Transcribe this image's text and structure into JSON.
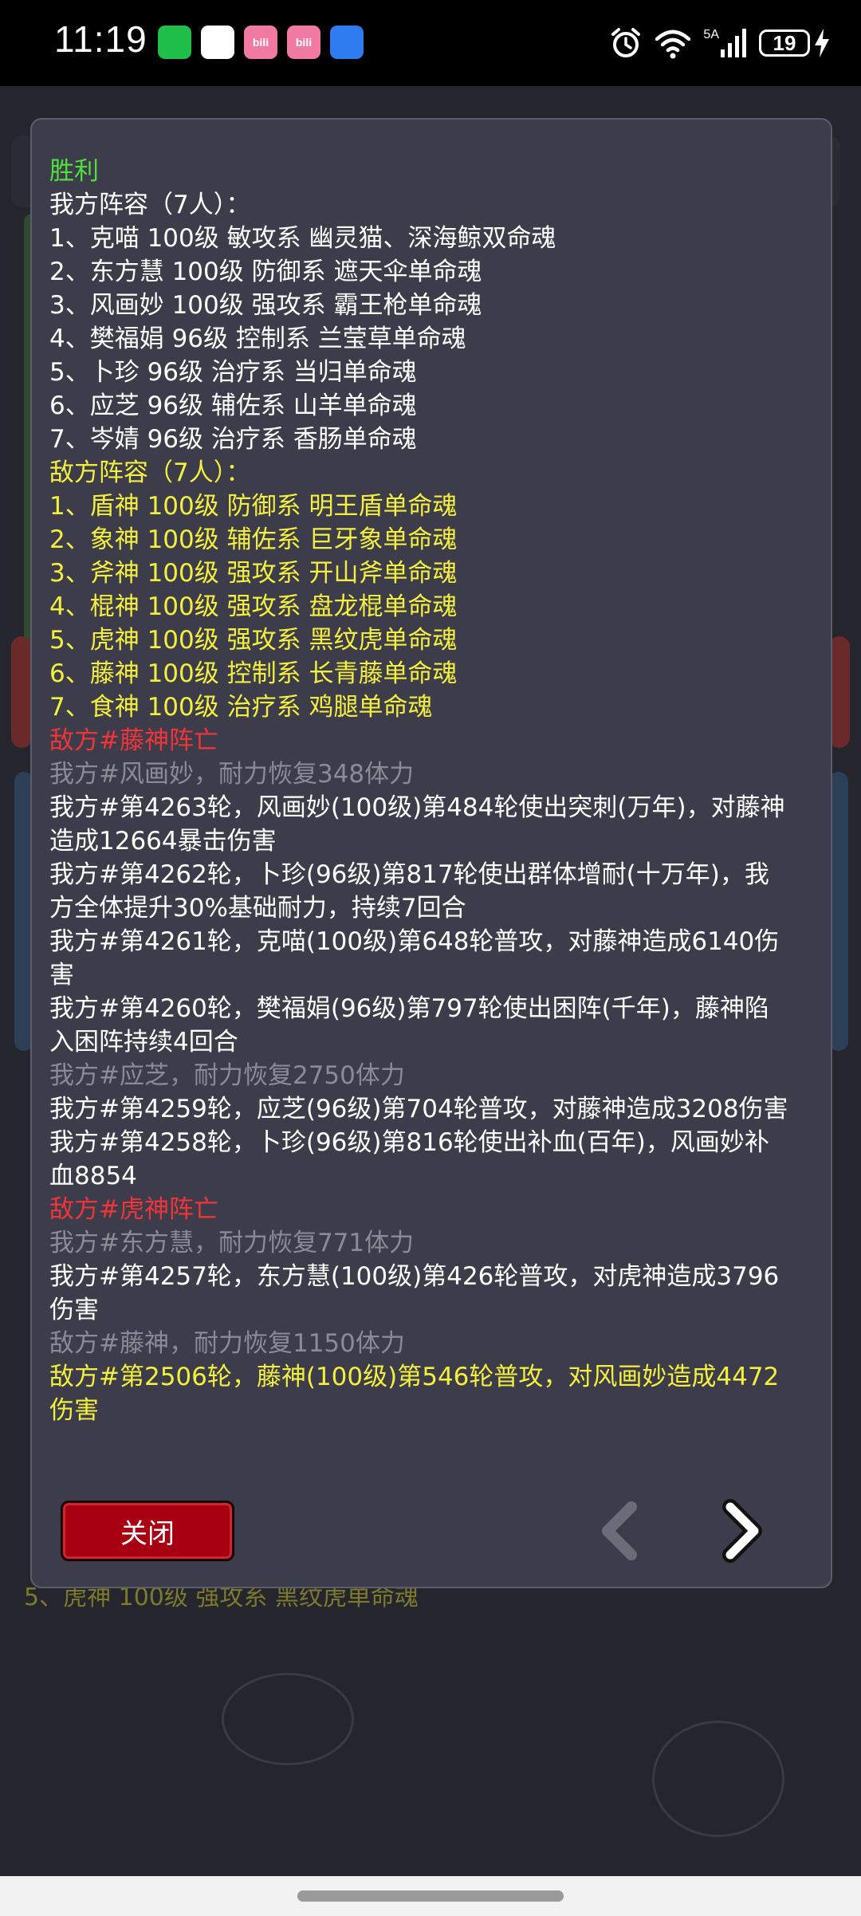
{
  "status_bar": {
    "time": "11:19",
    "apps": [
      {
        "icon": "wechat-icon",
        "color": "#1fbf4a",
        "text": ""
      },
      {
        "icon": "app-q-icon",
        "color": "#ffffff",
        "text": ""
      },
      {
        "icon": "bilibili-icon",
        "color": "#f07aa1",
        "text": "bili"
      },
      {
        "icon": "bilibili-icon-2",
        "color": "#f07aa1",
        "text": "bili"
      },
      {
        "icon": "message-icon",
        "color": "#2f7bf0",
        "text": ""
      }
    ],
    "network": "5A",
    "battery": "19"
  },
  "background": {
    "peek_text": "5、虎神 100级 强攻系 黑纹虎单命魂"
  },
  "dialog": {
    "log_lines": [
      {
        "color": "green",
        "text": "胜利"
      },
      {
        "color": "white",
        "text": "我方阵容（7人）："
      },
      {
        "color": "white",
        "text": "1、克喵 100级 敏攻系 幽灵猫、深海鲸双命魂"
      },
      {
        "color": "white",
        "text": "2、东方慧 100级 防御系 遮天伞单命魂"
      },
      {
        "color": "white",
        "text": "3、风画妙 100级 强攻系 霸王枪单命魂"
      },
      {
        "color": "white",
        "text": "4、樊福娟 96级 控制系 兰莹草单命魂"
      },
      {
        "color": "white",
        "text": "5、卜珍 96级 治疗系 当归单命魂"
      },
      {
        "color": "white",
        "text": "6、应芝 96级 辅佐系 山羊单命魂"
      },
      {
        "color": "white",
        "text": "7、岑婧 96级 治疗系 香肠单命魂"
      },
      {
        "color": "yellow",
        "text": "敌方阵容（7人）："
      },
      {
        "color": "yellow",
        "text": "1、盾神 100级 防御系 明王盾单命魂"
      },
      {
        "color": "yellow",
        "text": "2、象神 100级 辅佐系 巨牙象单命魂"
      },
      {
        "color": "yellow",
        "text": "3、斧神 100级 强攻系 开山斧单命魂"
      },
      {
        "color": "yellow",
        "text": "4、棍神 100级 强攻系 盘龙棍单命魂"
      },
      {
        "color": "yellow",
        "text": "5、虎神 100级 强攻系 黑纹虎单命魂"
      },
      {
        "color": "yellow",
        "text": "6、藤神 100级 控制系 长青藤单命魂"
      },
      {
        "color": "yellow",
        "text": "7、食神 100级 治疗系 鸡腿单命魂"
      },
      {
        "color": "red",
        "text": "敌方#藤神阵亡"
      },
      {
        "color": "gray",
        "text": "我方#风画妙，耐力恢复348体力"
      },
      {
        "color": "white",
        "text": "我方#第4263轮，风画妙(100级)第484轮使出突刺(万年)，对藤神\n造成12664暴击伤害"
      },
      {
        "color": "white",
        "text": "我方#第4262轮，卜珍(96级)第817轮使出群体增耐(十万年)，我\n方全体提升30%基础耐力，持续7回合"
      },
      {
        "color": "white",
        "text": "我方#第4261轮，克喵(100级)第648轮普攻，对藤神造成6140伤\n害"
      },
      {
        "color": "white",
        "text": "我方#第4260轮，樊福娟(96级)第797轮使出困阵(千年)，藤神陷\n入困阵持续4回合"
      },
      {
        "color": "gray",
        "text": "我方#应芝，耐力恢复2750体力"
      },
      {
        "color": "white",
        "text": "我方#第4259轮，应芝(96级)第704轮普攻，对藤神造成3208伤害"
      },
      {
        "color": "white",
        "text": "我方#第4258轮，卜珍(96级)第816轮使出补血(百年)，风画妙补\n血8854"
      },
      {
        "color": "red",
        "text": "敌方#虎神阵亡"
      },
      {
        "color": "gray",
        "text": "我方#东方慧，耐力恢复771体力"
      },
      {
        "color": "white",
        "text": "我方#第4257轮，东方慧(100级)第426轮普攻，对虎神造成3796\n伤害"
      },
      {
        "color": "gray",
        "text": "敌方#藤神，耐力恢复1150体力"
      },
      {
        "color": "yellow",
        "text": "敌方#第2506轮，藤神(100级)第546轮普攻，对风画妙造成4472\n伤害"
      }
    ],
    "close_label": "关闭"
  }
}
